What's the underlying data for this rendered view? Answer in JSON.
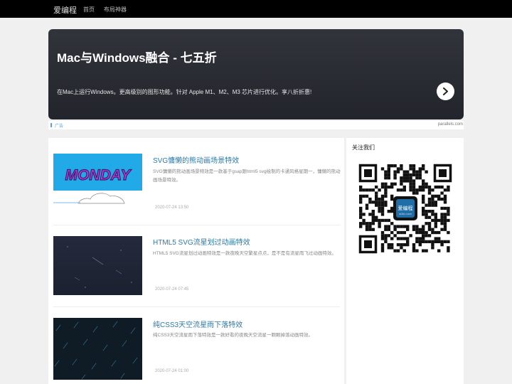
{
  "nav": {
    "brand": "爱编程",
    "items": [
      "首页",
      "布局神器"
    ]
  },
  "banner": {
    "title": "Mac与Windows融合 - 七五折",
    "description": "在Mac上运行Windows。更高级别的图形功能。针对 Apple M1、M2、M3 芯片进行优化。享八折折惠!",
    "arrow_icon": "chevron-right-icon"
  },
  "ad": {
    "label": "广告",
    "domain": "parallels.com"
  },
  "articles": [
    {
      "title": "SVG慵懒的熊动画场景特效",
      "description": "SVG慵懒的熊动画场景特效是一款基于gsap跟html5 svg绘制的卡通风格星期一，慵懒的熊动画场景特效。",
      "date": "2020-07-24 13:50",
      "thumb_text": "MONDAY"
    },
    {
      "title": "HTML5 SVG流星划过动画特效",
      "description": "HTML5 SVG流星划过动画特效是一款夜晚天空繁星点点，是不是有流星雨飞过动画特效。",
      "date": "2020-07-24 07:45"
    },
    {
      "title": "纯CSS3天空流星雨下落特效",
      "description": "纯CSS3天空流星雨下落特效是一款好看的夜晚天空流星一颗颗掉落动画特效。",
      "date": "2020-07-24 01:00"
    }
  ],
  "sidebar": {
    "title": "关注我们",
    "qr_center_text": "爱编程",
    "qr_center_subtext": "w2bc.com"
  },
  "colors": {
    "topbar": "#000000",
    "link": "#2e7aa6",
    "banner_bg": "#2a2d33"
  }
}
